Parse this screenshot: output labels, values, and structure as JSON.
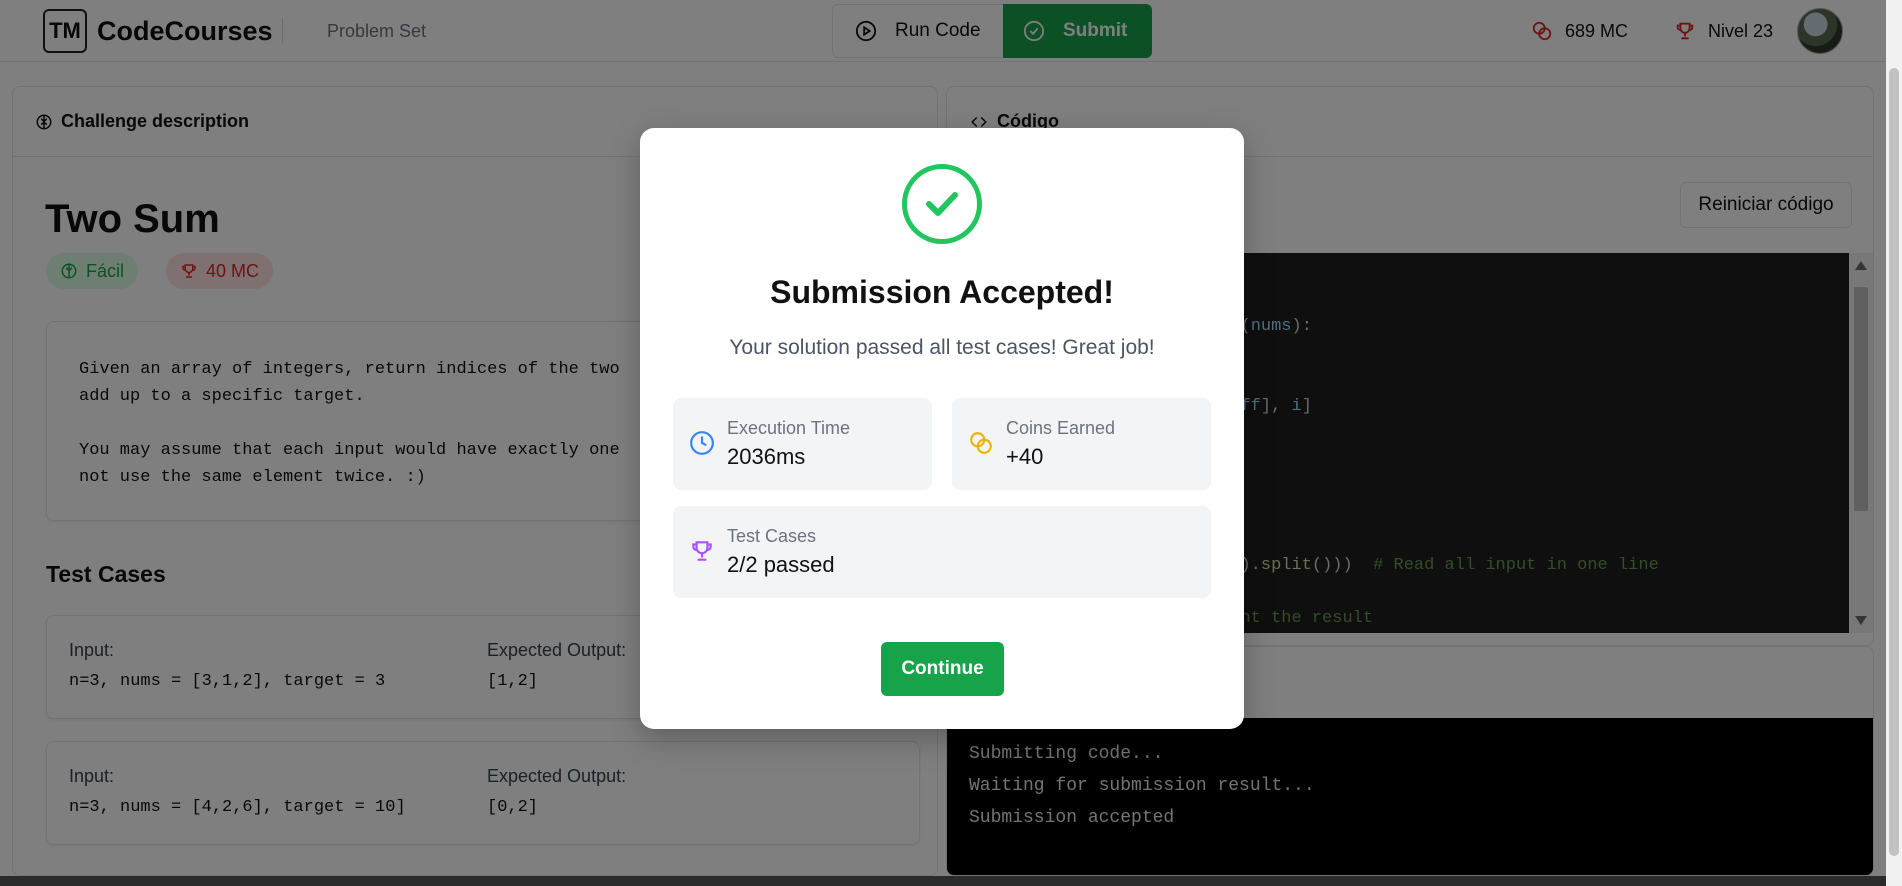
{
  "header": {
    "logo_text": "TM",
    "brand": "CodeCourses",
    "nav_problem_set": "Problem Set",
    "run_label": "Run Code",
    "submit_label": "Submit",
    "coins": "689 MC",
    "level": "Nivel 23"
  },
  "left": {
    "panel_title": "Challenge description",
    "problem_title": "Two Sum",
    "difficulty": "Fácil",
    "reward": "40 MC",
    "description": "Given an array of integers, return indices of the two \nadd up to a specific target.\n\nYou may assume that each input would have exactly one \nnot use the same element twice. :)",
    "test_cases_title": "Test Cases",
    "test_cases": [
      {
        "input_label": "Input:",
        "input": "n=3, nums = [3,1,2], target = 3",
        "output_label": "Expected Output:",
        "output": "[1,2]"
      },
      {
        "input_label": "Input:",
        "input": "n=3, nums = [4,2,6], target = 10]",
        "output_label": "Expected Output:",
        "output": "[0,2]"
      }
    ]
  },
  "right": {
    "panel_title": "Código",
    "reset_label": "Reiniciar código",
    "console_lines": [
      "Submitting code...",
      "Waiting for submission result...",
      "Submission accepted"
    ]
  },
  "modal": {
    "title": "Submission Accepted!",
    "subtitle": "Your solution passed all test cases! Great job!",
    "exec_label": "Execution Time",
    "exec_value": "2036ms",
    "coins_label": "Coins Earned",
    "coins_value": "+40",
    "tests_label": "Test Cases",
    "tests_value": "2/2 passed",
    "continue_label": "Continue"
  },
  "colors": {
    "accent_green": "#16a34a",
    "success_ring": "#22c55e",
    "danger": "#dc2626"
  }
}
